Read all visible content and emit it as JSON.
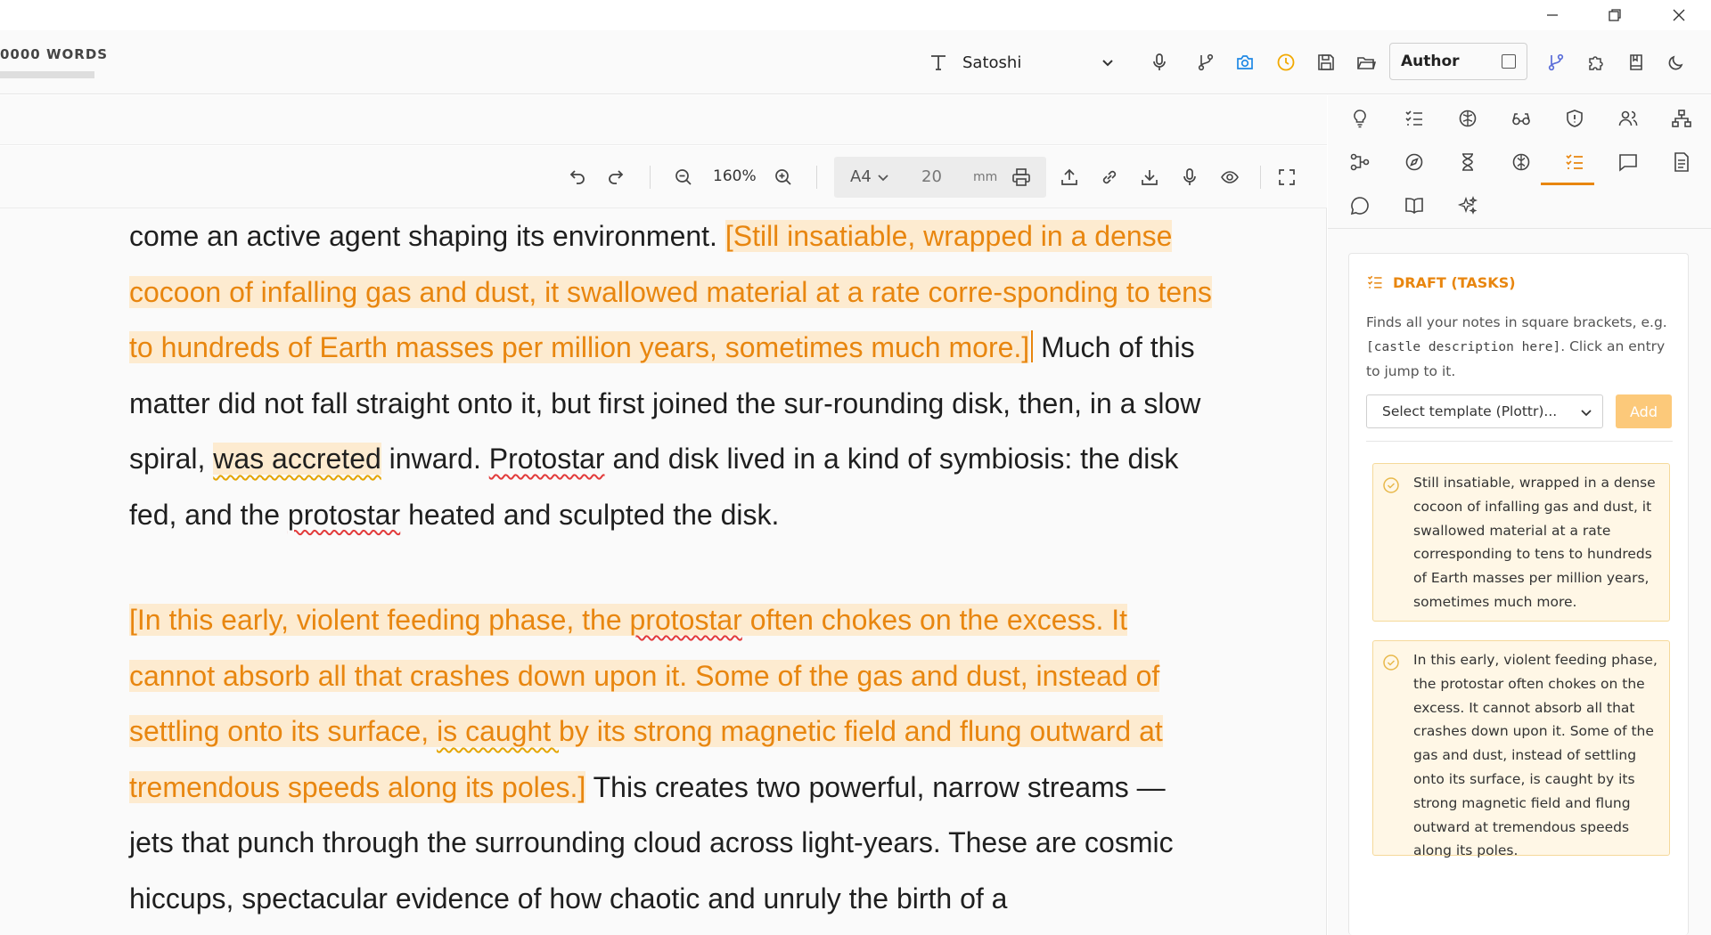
{
  "window": {
    "minimize_icon": "minimize-icon",
    "restore_icon": "restore-icon",
    "close_icon": "close-icon"
  },
  "header": {
    "word_count": "0000 WORDS",
    "font_name": "Satoshi",
    "author_label": "Author"
  },
  "editor_toolbar": {
    "zoom": "160%",
    "page_size": "A4",
    "margin_value": "20",
    "margin_unit": "mm"
  },
  "document": {
    "p1": {
      "t1": "come an active agent shaping its environment. ",
      "n1": "[Still insatiable, wrapped in a dense cocoon of infalling gas and dust, it swallowed material at a rate corre-sponding to tens to hundreds of Earth masses per million years, sometimes much more.]",
      "t2": " Much of this matter did not fall straight onto it, but first joined the sur-rounding disk, then, in a slow spiral, ",
      "g1": "was accreted",
      "t3": " inward. ",
      "s1": "Protostar",
      "t4": " and disk lived in a kind of symbiosis: the disk fed, and the ",
      "s2": "protostar",
      "t5": " heated and sculpted the disk."
    },
    "p2": {
      "n1a": "[In this early, violent feeding phase, the ",
      "s1": "protostar",
      "n1b": " often chokes on the excess. It cannot absorb all that crashes down upon it. Some of the gas and dust, instead of settling onto its surface, ",
      "g1": " is caught ",
      "n1c": " by its strong magnetic field and flung outward at tremendous speeds along its poles.]",
      "t1": " This creates two powerful, narrow streams — jets that punch through the surrounding cloud across light-years. These are cosmic hiccups, spectacular evidence of how chaotic and unruly the birth of a"
    }
  },
  "panel": {
    "title": "DRAFT (TASKS)",
    "desc_before": "Finds all your notes in square brackets, e.g. ",
    "desc_code": "[castle description here]",
    "desc_after": ". Click an entry to jump to it.",
    "template_select": "Select template (Plottr)...",
    "add_label": "Add",
    "tasks": [
      "Still insatiable, wrapped in a dense cocoon of infalling gas and dust, it swallowed material at a rate corresponding to tens to hundreds of Earth masses per million years, sometimes much more.",
      "In this early, violent feeding phase, the protostar often chokes on the excess. It cannot absorb all that crashes down upon it. Some of the gas and dust, instead of settling onto its surface, is caught by its strong magnetic field and flung outward at tremendous speeds along its poles."
    ]
  },
  "colors": {
    "accent": "#e8860f",
    "note_bg": "#fdebd0",
    "task_bg": "#fff7e6",
    "camera": "#1e88e5",
    "clock": "#f2a900",
    "branch": "#5a6dd8"
  }
}
